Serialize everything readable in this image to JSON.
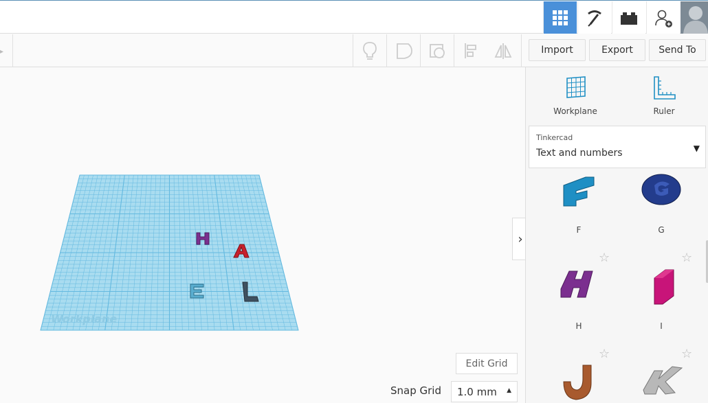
{
  "topbar": {
    "buttons": [
      {
        "name": "grid-view-icon",
        "active": true
      },
      {
        "name": "pickaxe-icon",
        "active": false
      },
      {
        "name": "bricks-icon",
        "active": false
      },
      {
        "name": "add-user-icon",
        "active": false
      }
    ]
  },
  "toolbar": {
    "import_label": "Import",
    "export_label": "Export",
    "send_to_label": "Send To",
    "icons": [
      "lightbulb-icon",
      "note-icon",
      "show-all-icon",
      "align-icon",
      "mirror-icon"
    ]
  },
  "workplane": {
    "watermark": "Workplane",
    "letters": [
      {
        "char": "H",
        "color": "#7b2f8f"
      },
      {
        "char": "A",
        "color": "#c8202c"
      },
      {
        "char": "E",
        "color": "#5aaed0"
      },
      {
        "char": "L",
        "color": "#3f5160"
      }
    ]
  },
  "panel": {
    "workplane_label": "Workplane",
    "ruler_label": "Ruler",
    "library_small": "Tinkercad",
    "library_value": "Text and numbers",
    "shapes": [
      {
        "label": "F",
        "color": "#1f8fc4"
      },
      {
        "label": "G",
        "color": "#233c8c"
      },
      {
        "label": "H",
        "color": "#7b2f8f"
      },
      {
        "label": "I",
        "color": "#c81479"
      },
      {
        "label": "J",
        "color": "#a85a2e"
      },
      {
        "label": "K",
        "color": "#b8b8b8"
      }
    ]
  },
  "canvas": {
    "edit_grid_label": "Edit Grid",
    "snap_grid_label": "Snap Grid",
    "snap_grid_value": "1.0 mm",
    "collapse_icon": "›"
  },
  "colors": {
    "accent": "#4a90d9",
    "workplane_fill": "#a9dcf0",
    "workplane_line": "#63b9df"
  }
}
